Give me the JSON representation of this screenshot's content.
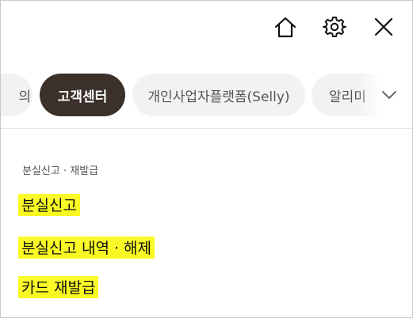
{
  "header": {
    "icons": [
      "home-icon",
      "gear-icon",
      "close-icon"
    ]
  },
  "categories": {
    "items": [
      {
        "label": "의",
        "active": false
      },
      {
        "label": "고객센터",
        "active": true
      },
      {
        "label": "개인사업자플랫폼(Selly)",
        "active": false
      },
      {
        "label": "알리미",
        "active": false
      }
    ],
    "expand_icon": "chevron-down-icon",
    "active_color": "#3b302a",
    "inactive_color": "#f2f2f2"
  },
  "content": {
    "section_title": "분실신고 · 재발급",
    "items": [
      {
        "label": "분실신고"
      },
      {
        "label": "분실신고 내역 · 해제"
      },
      {
        "label": "카드 재발급"
      }
    ],
    "highlight_color": "#f8f81f"
  }
}
